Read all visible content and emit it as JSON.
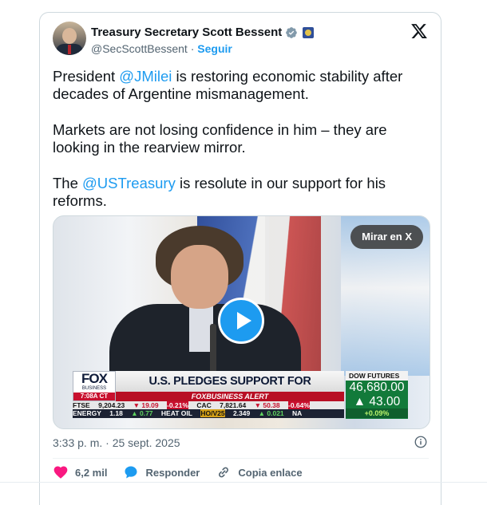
{
  "author": {
    "display_name": "Treasury Secretary Scott Bessent",
    "handle": "@SecScottBessent",
    "separator": "·",
    "follow_label": "Seguir"
  },
  "tweet": {
    "p1_before": "President ",
    "p1_mention": "@JMilei",
    "p1_after": " is restoring economic stability after decades of Argentine mismanagement.",
    "p2": "Markets are not losing confidence in him – they are looking in the rearview mirror.",
    "p3_before": "The ",
    "p3_mention": "@USTreasury",
    "p3_after": " is resolute in our support for his reforms."
  },
  "media": {
    "watch_label": "Mirar en X",
    "fox_logo": "FOX",
    "fox_sub": "BUSINESS",
    "fox_time": "7:08A CT",
    "headline": "U.S. PLEDGES SUPPORT FOR ARGENTINA'S ECONOMY",
    "alert": "FOXBUSINESS ALERT",
    "ticker_row1": [
      "FTSE",
      "9,204.23",
      "▼ 19.09",
      "-0.21%",
      "CAC",
      "7,821.64",
      "▼ 50.38",
      "-0.64%"
    ],
    "ticker_row2": [
      "ENERGY",
      "1.18",
      "▲ 0.77",
      "HEAT OIL",
      "HO/V25",
      "2.349",
      "▲ 0.021",
      "NA"
    ],
    "dow_label": "DOW FUTURES",
    "dow_value": "46,680.00",
    "dow_change": "▲ 43.00",
    "dow_pct": "+0.09%"
  },
  "timestamp": "3:33 p. m. · 25 sept. 2025",
  "actions": {
    "likes": "6,2 mil",
    "reply": "Responder",
    "copy_link": "Copia enlace"
  },
  "colors": {
    "link": "#1d9bf0",
    "like": "#f91880",
    "muted": "#536471"
  }
}
